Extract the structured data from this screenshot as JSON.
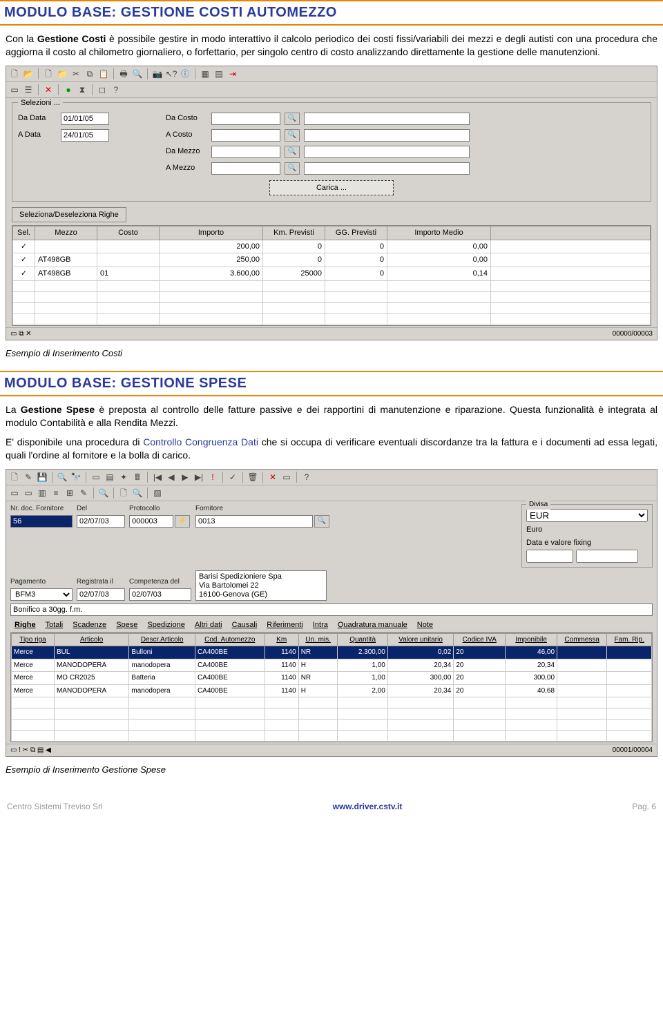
{
  "section1": {
    "title": "MODULO BASE: GESTIONE COSTI AUTOMEZZO",
    "para_lead": "Con la ",
    "para_bold1": "Gestione Costi",
    "para_rest": " è possibile gestire in modo interattivo il calcolo periodico dei costi fissi/variabili dei mezzi e degli autisti con una procedura che aggiorna il costo al chilometro giornaliero, o forfettario, per singolo centro di costo analizzando direttamente la gestione delle manutenzioni.",
    "caption": "Esempio di Inserimento Costi"
  },
  "win1": {
    "selezioni_legend": "Selezioni ...",
    "labels": {
      "da_data": "Da Data",
      "a_data": "A Data",
      "da_costo": "Da Costo",
      "a_costo": "A Costo",
      "da_mezzo": "Da Mezzo",
      "a_mezzo": "A Mezzo"
    },
    "values": {
      "da_data": "01/01/05",
      "a_data": "24/01/05"
    },
    "btn_carica": "Carica ...",
    "btn_seldesel": "Seleziona/Deseleziona Righe",
    "headers": [
      "Sel.",
      "Mezzo",
      "Costo",
      "Importo",
      "Km. Previsti",
      "GG. Previsti",
      "Importo Medio"
    ],
    "rows": [
      {
        "sel": "✓",
        "mezzo": "",
        "costo": "",
        "importo": "200,00",
        "km": "0",
        "gg": "0",
        "medio": "0,00"
      },
      {
        "sel": "✓",
        "mezzo": "AT498GB",
        "costo": "",
        "importo": "250,00",
        "km": "0",
        "gg": "0",
        "medio": "0,00"
      },
      {
        "sel": "✓",
        "mezzo": "AT498GB",
        "costo": "01",
        "importo": "3.600,00",
        "km": "25000",
        "gg": "0",
        "medio": "0,14"
      }
    ],
    "status_right": "00000/00003"
  },
  "section2": {
    "title": "MODULO BASE: GESTIONE SPESE",
    "p1a": "La ",
    "p1b": "Gestione Spese",
    "p1c": " è preposta al controllo delle fatture passive e dei rapportini di manutenzione e riparazione. Questa funzionalità è integrata al modulo Contabilità e alla Rendita Mezzi.",
    "p2a": "E' disponibile una procedura di ",
    "p2b": "Controllo Congruenza Dati",
    "p2c": " che si occupa di verificare eventuali discordanze tra la fattura e i documenti ad essa legati, quali l'ordine al fornitore e la bolla di carico.",
    "caption": "Esempio di Inserimento Gestione Spese"
  },
  "win2": {
    "labels": {
      "nr_doc": "Nr. doc. Fornitore",
      "del": "Del",
      "protocollo": "Protocollo",
      "fornitore": "Fornitore",
      "pagamento": "Pagamento",
      "registrata": "Registrata il",
      "competenza": "Competenza del",
      "divisa": "Divisa",
      "divisa_name": "Euro",
      "dvf": "Data e valore fixing"
    },
    "values": {
      "nr_doc": "56",
      "del": "02/07/03",
      "protocollo": "000003",
      "fornitore": "0013",
      "pagamento": "BFM3",
      "registrata": "02/07/03",
      "competenza": "02/07/03",
      "divisa": "EUR",
      "addr": "Barisi Spedizioniere Spa\nVia Bartolomei 22\n16100-Genova (GE)",
      "bonifico": "Bonifico a 30gg. f.m."
    },
    "tabs": [
      "Righe",
      "Totali",
      "Scadenze",
      "Spese",
      "Spedizione",
      "Altri dati",
      "Causali",
      "Riferimenti",
      "Intra",
      "Quadratura manuale",
      "Note"
    ],
    "headers": [
      "Tipo riga",
      "Articolo",
      "Descr.Articolo",
      "Cod. Automezzo",
      "Km",
      "Un. mis.",
      "Quantità",
      "Valore unitario",
      "Codice IVA",
      "Imponibile",
      "Commessa",
      "Fam. Rip."
    ],
    "rows": [
      {
        "tipo": "Merce",
        "art": "BUL",
        "desc": "Bulloni",
        "cod": "CA400BE",
        "km": "1140",
        "um": "NR",
        "q": "2.300,00",
        "vu": "0,02",
        "iva": "20",
        "imp": "46,00",
        "com": "",
        "fr": ""
      },
      {
        "tipo": "Merce",
        "art": "MANODOPERA",
        "desc": "manodopera",
        "cod": "CA400BE",
        "km": "1140",
        "um": "H",
        "q": "1,00",
        "vu": "20,34",
        "iva": "20",
        "imp": "20,34",
        "com": "",
        "fr": ""
      },
      {
        "tipo": "Merce",
        "art": "MO CR2025",
        "desc": "Batteria",
        "cod": "CA400BE",
        "km": "1140",
        "um": "NR",
        "q": "1,00",
        "vu": "300,00",
        "iva": "20",
        "imp": "300,00",
        "com": "",
        "fr": ""
      },
      {
        "tipo": "Merce",
        "art": "MANODOPERA",
        "desc": "manodopera",
        "cod": "CA400BE",
        "km": "1140",
        "um": "H",
        "q": "2,00",
        "vu": "20,34",
        "iva": "20",
        "imp": "40,68",
        "com": "",
        "fr": ""
      }
    ],
    "status_right": "00001/00004"
  },
  "footer": {
    "left": "Centro Sistemi Treviso Srl",
    "mid": "www.driver.cstv.it",
    "right": "Pag. 6"
  }
}
